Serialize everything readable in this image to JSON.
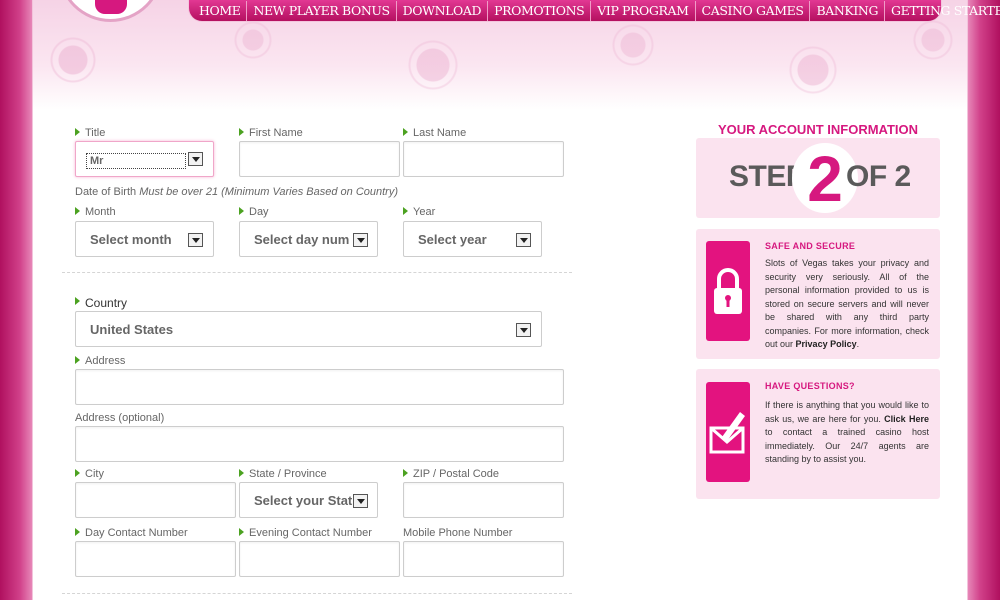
{
  "nav": {
    "items": [
      "HOME",
      "NEW PLAYER BONUS",
      "DOWNLOAD",
      "PROMOTIONS",
      "VIP PROGRAM",
      "CASINO GAMES",
      "BANKING",
      "GETTING STARTED"
    ]
  },
  "form": {
    "title_label": "Title",
    "title_value": "Mr",
    "first_name_label": "First Name",
    "last_name_label": "Last Name",
    "dob_note": "Date of Birth",
    "dob_note_em": "Must be over 21 (Minimum Varies Based on Country)",
    "month_label": "Month",
    "month_value": "Select month",
    "day_label": "Day",
    "day_value": "Select day num",
    "year_label": "Year",
    "year_value": "Select year",
    "country_label": "Country",
    "country_value": "United States",
    "address_label": "Address",
    "address_opt_label": "Address (optional)",
    "city_label": "City",
    "state_label": "State / Province",
    "state_value": "Select your Stat",
    "zip_label": "ZIP / Postal Code",
    "day_contact_label": "Day Contact Number",
    "evening_contact_label": "Evening Contact Number",
    "mobile_label": "Mobile Phone Number"
  },
  "sidebar": {
    "title": "YOUR ACCOUNT INFORMATION",
    "step_prefix": "STEP",
    "step_number": "2",
    "step_suffix": "OF 2",
    "safe": {
      "title": "SAFE AND SECURE",
      "text": "Slots of Vegas takes your privacy and security very seriously. All of the personal information provided to us is stored on secure servers and will never be shared with any third party companies. For more information, check out our",
      "link": "Privacy Policy",
      "end": "."
    },
    "questions": {
      "title": "HAVE QUESTIONS?",
      "text_a": "If there is anything that you would like to ask us, we are here for you.",
      "link": "Click Here",
      "text_b": "to contact a trained casino host immediately. Our 24/7 agents are standing by to assist you."
    }
  },
  "colors": {
    "brand_pink": "#d6187f",
    "required_arrow": "#4ca221",
    "panel_bg": "#fbe3ef"
  }
}
